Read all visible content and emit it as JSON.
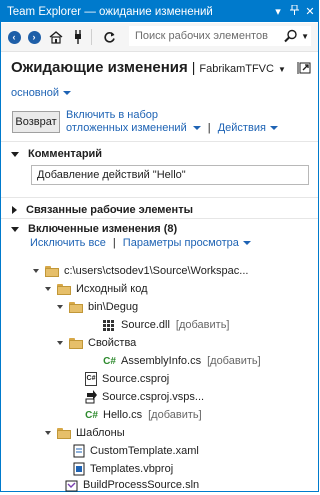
{
  "window": {
    "title": "Team Explorer — ожидание изменений",
    "controls": [
      "dropdown-icon",
      "pin-icon",
      "close-icon"
    ]
  },
  "toolbar": {
    "search_placeholder": "Поиск рабочих элементов"
  },
  "header": {
    "title": "Ожидающие изменения",
    "project": "FabrikamTFVC"
  },
  "branch": {
    "label": "основной"
  },
  "actions": {
    "shelve_button": "Возврат",
    "shelve_link_line1": "Включить в набор",
    "shelve_link_line2": "отложенных изменений",
    "actions_link": "Действия"
  },
  "comment_section": {
    "heading": "Комментарий",
    "value": "Добавление действий \"Hello\""
  },
  "work_items_section": {
    "heading": "Связанные рабочие элементы"
  },
  "included_section": {
    "heading": "Включенные изменения (8)",
    "exclude_all": "Исключить все",
    "view_options": "Параметры просмотра"
  },
  "tree": [
    {
      "label": "c:\\users\\ctsodev1\\Source\\Workspac...",
      "status": ""
    },
    {
      "label": "Исходный код",
      "status": ""
    },
    {
      "label": "bin\\Degug",
      "status": ""
    },
    {
      "label": "Source.dll",
      "status": "[добавить]"
    },
    {
      "label": "Свойства",
      "status": ""
    },
    {
      "label": "AssemblyInfo.cs",
      "status": "[добавить]"
    },
    {
      "label": "Source.csproj",
      "status": ""
    },
    {
      "label": "Source.csproj.vsps...",
      "status": ""
    },
    {
      "label": "Hello.cs",
      "status": "[добавить]"
    },
    {
      "label": "Шаблоны",
      "status": ""
    },
    {
      "label": "CustomTemplate.xaml",
      "status": ""
    },
    {
      "label": "Templates.vbproj",
      "status": ""
    },
    {
      "label": "BuildProcessSource.sln",
      "status": ""
    }
  ],
  "colors": {
    "accent": "#007acc",
    "link": "#1e63b4",
    "folder": "#e6bf6a",
    "cs_file": "#2d8a2d"
  }
}
